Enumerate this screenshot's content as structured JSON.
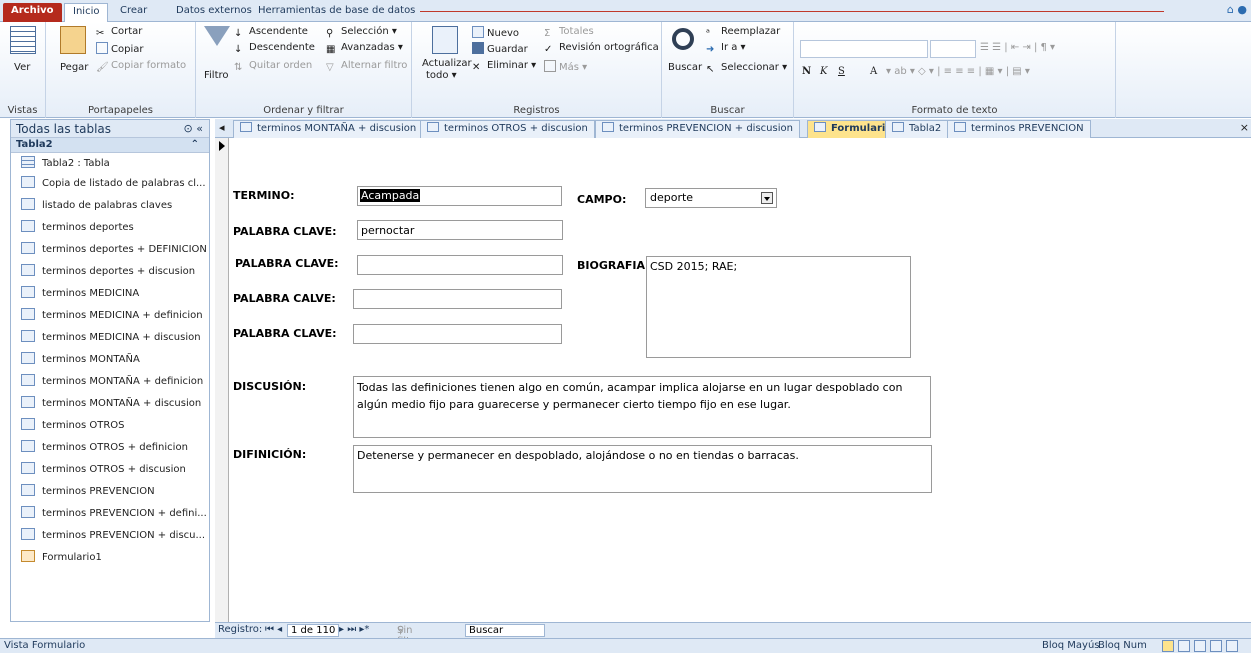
{
  "ribbon_tabs": {
    "archivo": "Archivo",
    "inicio": "Inicio",
    "crear": "Crear",
    "datos_externos": "Datos externos",
    "herramientas": "Herramientas de base de datos"
  },
  "groups": {
    "vistas": {
      "label": "Vistas",
      "ver": "Ver"
    },
    "portapapeles": {
      "label": "Portapapeles",
      "pegar": "Pegar",
      "cortar": "Cortar",
      "copiar": "Copiar",
      "copiar_formato": "Copiar formato"
    },
    "ordenar": {
      "label": "Ordenar y filtrar",
      "filtro": "Filtro",
      "ascendente": "Ascendente",
      "descendente": "Descendente",
      "quitar_orden": "Quitar orden",
      "seleccion": "Selección ▾",
      "avanzadas": "Avanzadas ▾",
      "alternar_filtro": "Alternar filtro"
    },
    "registros": {
      "label": "Registros",
      "actualizar": "Actualizar",
      "todo": "todo ▾",
      "nuevo": "Nuevo",
      "guardar": "Guardar",
      "eliminar": "Eliminar ▾",
      "totales": "Totales",
      "revision": "Revisión ortográfica",
      "mas": "Más ▾"
    },
    "buscar": {
      "label": "Buscar",
      "buscar": "Buscar",
      "reemplazar": "Reemplazar",
      "ir_a": "Ir a ▾",
      "seleccionar": "Seleccionar ▾"
    },
    "formato": {
      "label": "Formato de texto",
      "bold": "N",
      "italic": "K",
      "underline": "S",
      "font_color": "A"
    }
  },
  "nav": {
    "header": "Todas las tablas",
    "group": "Tabla2",
    "items": [
      {
        "label": "Tabla2 : Tabla",
        "type": "table"
      },
      {
        "label": "Copia de listado de palabras cl...",
        "type": "query"
      },
      {
        "label": "listado de palabras claves",
        "type": "query"
      },
      {
        "label": "terminos deportes",
        "type": "query"
      },
      {
        "label": "terminos deportes + DEFINICION",
        "type": "query"
      },
      {
        "label": "terminos deportes + discusion",
        "type": "query"
      },
      {
        "label": "terminos MEDICINA",
        "type": "query"
      },
      {
        "label": "terminos MEDICINA + definicion",
        "type": "query"
      },
      {
        "label": "terminos MEDICINA + discusion",
        "type": "query"
      },
      {
        "label": "terminos MONTAÑA",
        "type": "query"
      },
      {
        "label": "terminos MONTAÑA + definicion",
        "type": "query"
      },
      {
        "label": "terminos MONTAÑA + discusion",
        "type": "query"
      },
      {
        "label": "terminos OTROS",
        "type": "query"
      },
      {
        "label": "terminos OTROS + definicion",
        "type": "query"
      },
      {
        "label": "terminos OTROS + discusion",
        "type": "query"
      },
      {
        "label": "terminos PREVENCION",
        "type": "query"
      },
      {
        "label": "terminos PREVENCION + defini...",
        "type": "query"
      },
      {
        "label": "terminos PREVENCION + discu...",
        "type": "query"
      },
      {
        "label": "Formulario1",
        "type": "form"
      }
    ]
  },
  "doc_tabs": [
    {
      "label": "terminos MONTAÑA + discusion"
    },
    {
      "label": "terminos OTROS + discusion"
    },
    {
      "label": "terminos PREVENCION + discusion"
    },
    {
      "label": "Formulario1",
      "active": true
    },
    {
      "label": "Tabla2"
    },
    {
      "label": "terminos PREVENCION"
    }
  ],
  "form": {
    "termino_label": "TERMINO:",
    "termino_value": "Acampada",
    "campo_label": "CAMPO:",
    "campo_value": "deporte",
    "pc1_label": "PALABRA CLAVE:",
    "pc1_value": "pernoctar",
    "pc2_label": "PALABRA CLAVE:",
    "pc2_value": "",
    "pc3_label": "PALABRA CALVE:",
    "pc3_value": "",
    "pc4_label": "PALABRA CLAVE:",
    "pc4_value": "",
    "biografia_label": "BIOGRAFIA:",
    "biografia_value": "CSD 2015; RAE;",
    "discusion_label": "DISCUSIÓN:",
    "discusion_value": "Todas las definiciones tienen algo en común, acampar implica alojarse en un lugar despoblado con algún medio fijo para guarecerse y permanecer cierto tiempo fijo en ese lugar.",
    "definicion_label": "DIFINICIÓN:",
    "definicion_value": "Detenerse y permanecer en despoblado, alojándose o no en tiendas o barracas."
  },
  "record_nav": {
    "label": "Registro:",
    "count": "1 de 110",
    "filter": "Sin filtro",
    "search": "Buscar"
  },
  "status": {
    "left": "Vista Formulario",
    "caps": "Bloq Mayús",
    "num": "Bloq Num"
  }
}
